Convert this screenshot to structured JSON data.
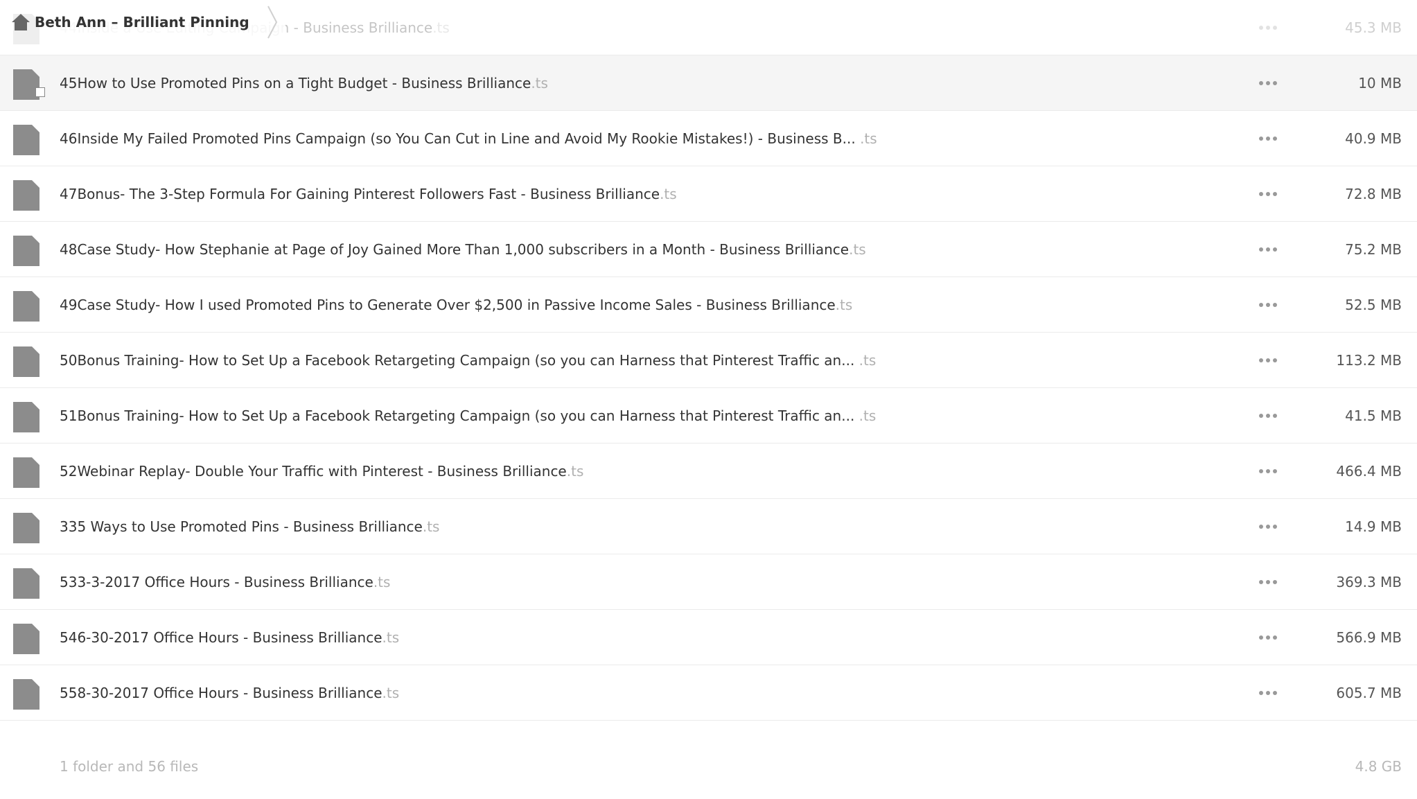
{
  "breadcrumb": {
    "label": "Beth Ann – Brilliant Pinning",
    "home_icon": "home-icon"
  },
  "files": [
    {
      "name": "44Inside a Use Editing Campaign - Business Brilliance",
      "ext": ".ts",
      "size": "45.3 MB"
    },
    {
      "name": "45How to Use Promoted Pins on a Tight Budget - Business Brilliance",
      "ext": ".ts",
      "size": "10 MB"
    },
    {
      "name": "46Inside My Failed Promoted Pins Campaign (so You Can Cut in Line and Avoid My Rookie Mistakes!) - Business B...",
      "ext": ".ts",
      "size": "40.9 MB"
    },
    {
      "name": "47Bonus- The 3-Step Formula For Gaining Pinterest Followers Fast - Business Brilliance",
      "ext": ".ts",
      "size": "72.8 MB"
    },
    {
      "name": "48Case Study- How Stephanie at Page of Joy Gained More Than 1,000 subscribers in a Month - Business Brilliance",
      "ext": ".ts",
      "size": "75.2 MB"
    },
    {
      "name": "49Case Study- How I used Promoted Pins to Generate Over $2,500 in Passive Income Sales - Business Brilliance",
      "ext": ".ts",
      "size": "52.5 MB"
    },
    {
      "name": "50Bonus Training- How to Set Up a Facebook Retargeting Campaign (so you can Harness that Pinterest Traffic an...",
      "ext": ".ts",
      "size": "113.2 MB"
    },
    {
      "name": "51Bonus Training- How to Set Up a Facebook Retargeting Campaign (so you can Harness that Pinterest Traffic an...",
      "ext": ".ts",
      "size": "41.5 MB"
    },
    {
      "name": "52Webinar Replay- Double Your Traffic with Pinterest - Business Brilliance",
      "ext": ".ts",
      "size": "466.4 MB"
    },
    {
      "name": "335 Ways to Use Promoted Pins - Business Brilliance",
      "ext": ".ts",
      "size": "14.9 MB"
    },
    {
      "name": "533-3-2017 Office Hours - Business Brilliance",
      "ext": ".ts",
      "size": "369.3 MB"
    },
    {
      "name": "546-30-2017 Office Hours - Business Brilliance",
      "ext": ".ts",
      "size": "566.9 MB"
    },
    {
      "name": "558-30-2017 Office Hours - Business Brilliance",
      "ext": ".ts",
      "size": "605.7 MB"
    }
  ],
  "summary": {
    "count": "1 folder and 56 files",
    "total_size": "4.8 GB"
  },
  "colors": {
    "icon_gray": "#8c8c8c",
    "extension_gray": "#b0b0b0",
    "hover_bg": "#f5f5f5",
    "divider": "#ebebeb"
  },
  "icons": {
    "file": "file-icon",
    "more": "more-options-icon",
    "separator": "chevron-right-icon"
  }
}
